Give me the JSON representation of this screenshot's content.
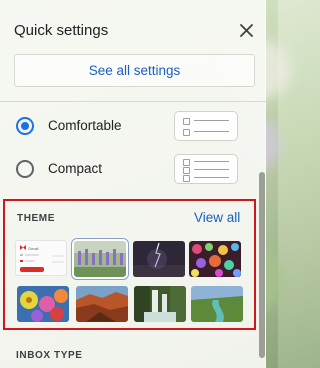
{
  "header": {
    "title": "Quick settings"
  },
  "buttons": {
    "see_all_settings": "See all settings"
  },
  "density": {
    "options": [
      {
        "label": "Comfortable",
        "selected": true
      },
      {
        "label": "Compact",
        "selected": false
      }
    ]
  },
  "theme": {
    "title": "THEME",
    "view_all": "View all",
    "thumbnails": [
      {
        "name": "default",
        "selected": false
      },
      {
        "name": "lavender-field",
        "selected": true
      },
      {
        "name": "lightning-storm",
        "selected": false
      },
      {
        "name": "bokeh-lights",
        "selected": false
      },
      {
        "name": "flowers",
        "selected": false
      },
      {
        "name": "canyon",
        "selected": false
      },
      {
        "name": "waterfall",
        "selected": false
      },
      {
        "name": "river-valley",
        "selected": false
      }
    ]
  },
  "inbox_type": {
    "title": "INBOX TYPE"
  },
  "mini_mail": {
    "app_name": "Gmail"
  },
  "colors": {
    "accent": "#1a73e8",
    "link": "#1a5fc4",
    "highlight": "#d0171c"
  }
}
